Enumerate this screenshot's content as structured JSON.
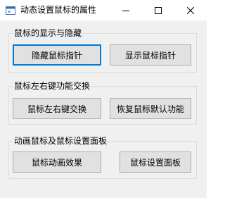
{
  "window": {
    "title": "动态设置鼠标的属性",
    "caption_buttons": [
      "minimize",
      "maximize",
      "close"
    ]
  },
  "groups": [
    {
      "label": "鼠标的显示与隐藏",
      "buttons": [
        {
          "label": "隐藏鼠标指针",
          "focused": true
        },
        {
          "label": "显示鼠标指针",
          "focused": false
        }
      ]
    },
    {
      "label": "鼠标左右键功能交换",
      "buttons": [
        {
          "label": "鼠标左右键交换",
          "focused": false
        },
        {
          "label": "恢复鼠标默认功能",
          "focused": false
        }
      ]
    },
    {
      "label": "动画鼠标及鼠标设置面板",
      "buttons": [
        {
          "label": "鼠标动画效果",
          "focused": false
        },
        {
          "label": "鼠标设置面板",
          "focused": false
        }
      ]
    }
  ],
  "colors": {
    "focus_border": "#0078d7",
    "button_face": "#e1e1e1",
    "window_bg": "#f0f0f0"
  },
  "icons": [
    "app-icon",
    "minimize-icon",
    "maximize-icon",
    "close-icon"
  ]
}
